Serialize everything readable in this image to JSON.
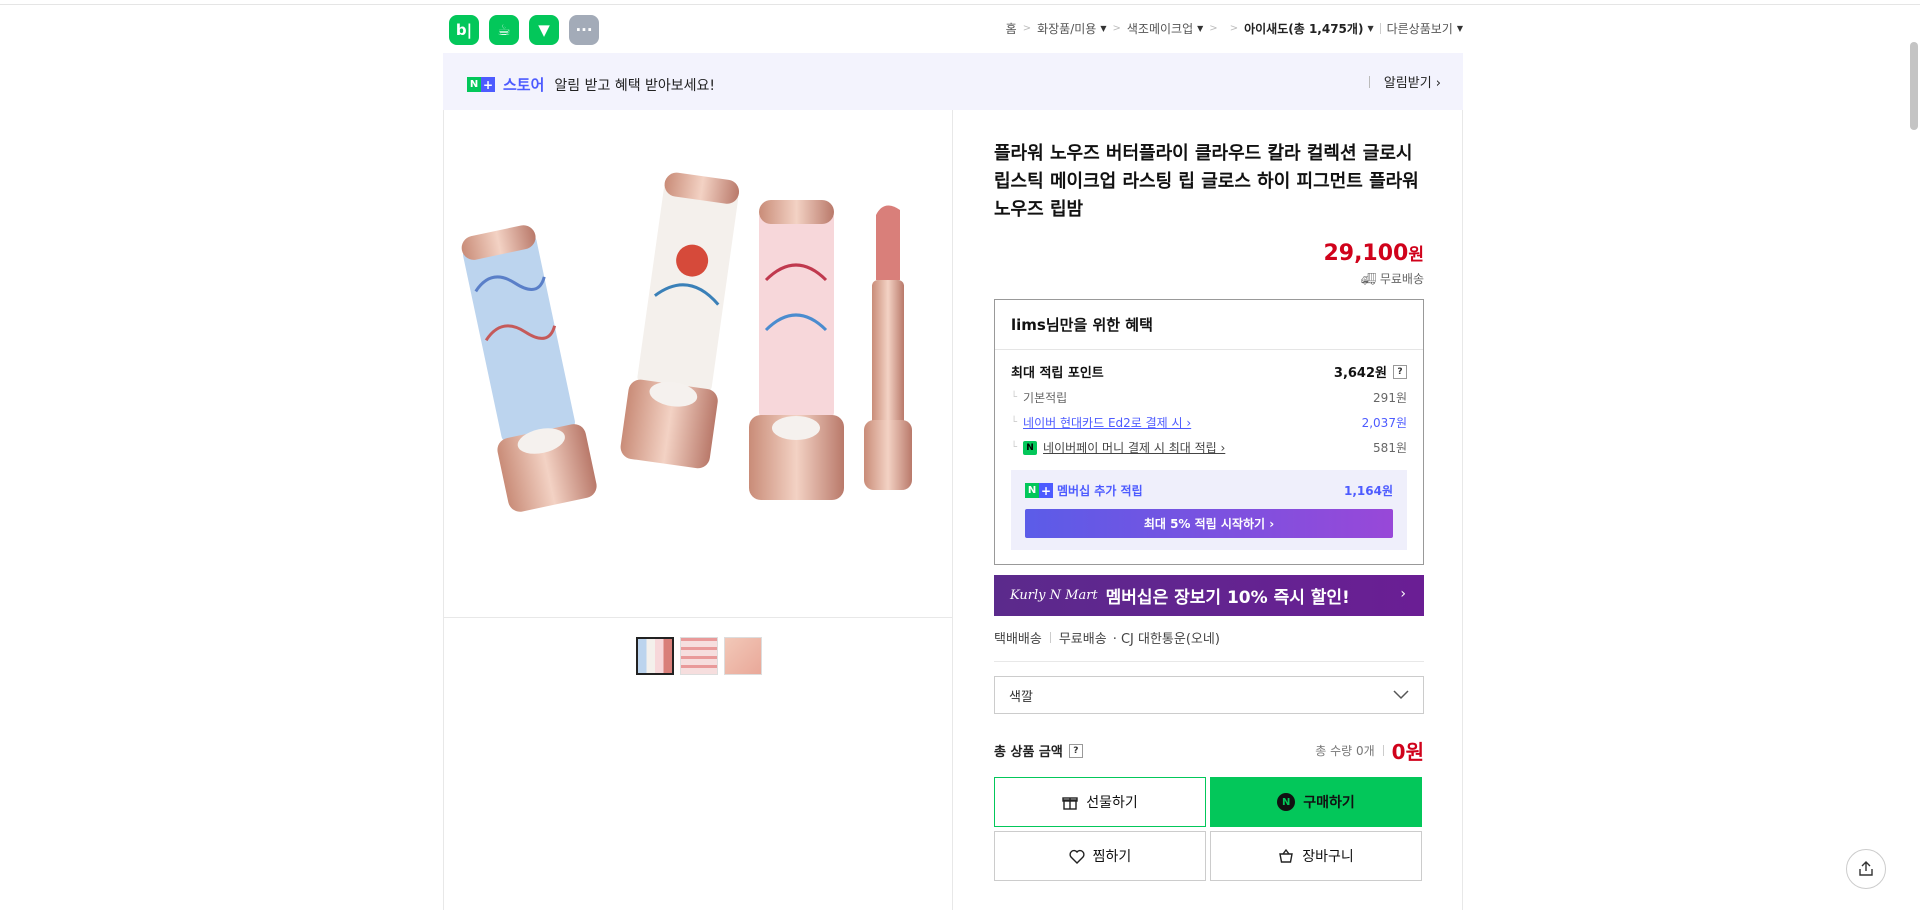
{
  "app_icons": [
    "b|",
    "☕",
    "▼",
    "···"
  ],
  "breadcrumb": {
    "home": "홈",
    "cat1": "화장품/미용",
    "cat2": "색조메이크업",
    "store": "아이새도(총 1,475개)",
    "other": "다른상품보기"
  },
  "store_bar": {
    "store_name": "스토어",
    "message": "알림 받고 혜택 받아보세요!",
    "subscribe": "알림받기 ›"
  },
  "product": {
    "title": "플라워 노우즈 버터플라이 클라우드 칼라 컬렉션 글로시 립스틱 메이크업 라스팅 립 글로스 하이 피그먼트 플라워노우즈 립밤",
    "price": "29,100",
    "price_unit": "원",
    "shipping": "무료배송"
  },
  "benefit": {
    "heading": "lims님만을 위한 혜택",
    "max_points_label": "최대 적립 포인트",
    "max_points_value": "3,642원",
    "rows": [
      {
        "label": "기본적립",
        "value": "291원"
      },
      {
        "label": "네이버 현대카드 Ed2로 결제 시 ›",
        "value": "2,037원"
      },
      {
        "label": "네이버페이 머니 결제 시 최대 적립 ›",
        "value": "581원"
      }
    ],
    "membership_label": "멤버십 추가 적립",
    "membership_value": "1,164원",
    "membership_button": "최대 5% 적립 시작하기 ›"
  },
  "banner": {
    "brand": "Kurly N Mart",
    "text": "멤버십은 장보기 10% 즉시 할인!",
    "chevron": "›"
  },
  "delivery": {
    "type": "택배배송",
    "fee": "무료배송",
    "carrier": "· CJ 대한통운(오네)"
  },
  "option_select": {
    "label": "색깔"
  },
  "total": {
    "label": "총 상품 금액",
    "qty": "총 수량 0개",
    "amount": "0원"
  },
  "buttons": {
    "gift": "선물하기",
    "buy": "구매하기",
    "wish": "찜하기",
    "cart": "장바구니"
  },
  "colors": {
    "naver_green": "#03c75a",
    "price_red": "#d0021b",
    "accent_blue": "#4d5bff"
  }
}
